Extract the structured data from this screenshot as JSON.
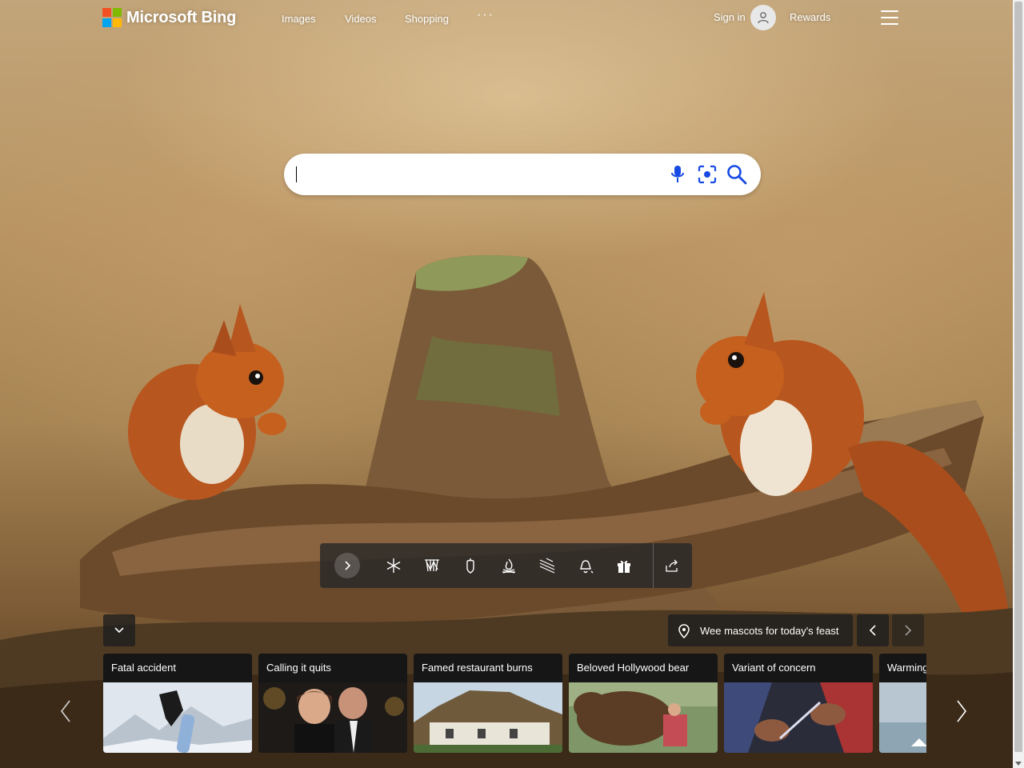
{
  "header": {
    "logo_text": "Microsoft Bing",
    "logo_colors": [
      "#f25022",
      "#7fba00",
      "#00a4ef",
      "#ffb900"
    ],
    "nav": [
      {
        "label": "Images"
      },
      {
        "label": "Videos"
      },
      {
        "label": "Shopping"
      },
      {
        "label": "···"
      }
    ],
    "sign_in": "Sign in",
    "rewards": "Rewards",
    "icons": {
      "avatar": "person-icon",
      "menu": "hamburger-icon"
    }
  },
  "search": {
    "value": "",
    "placeholder": "",
    "icons": [
      "microphone-icon",
      "visual-search-icon",
      "magnifier-icon"
    ],
    "accent": "#174ae4"
  },
  "toolbar": {
    "icons": [
      "chevron-right-icon",
      "snowflake-icon",
      "fence-icon",
      "acorn-icon",
      "campfire-icon",
      "snow-icon",
      "bell-icon",
      "gift-icon",
      "share-icon"
    ]
  },
  "caption": {
    "text": "Wee mascots for today's feast",
    "icons": [
      "location-pin-icon",
      "chevron-left-icon",
      "chevron-right-icon"
    ]
  },
  "news": [
    {
      "title": "Fatal accident"
    },
    {
      "title": "Calling it quits"
    },
    {
      "title": "Famed restaurant burns"
    },
    {
      "title": "Beloved Hollywood bear"
    },
    {
      "title": "Variant of concern"
    },
    {
      "title": "Warming"
    }
  ]
}
